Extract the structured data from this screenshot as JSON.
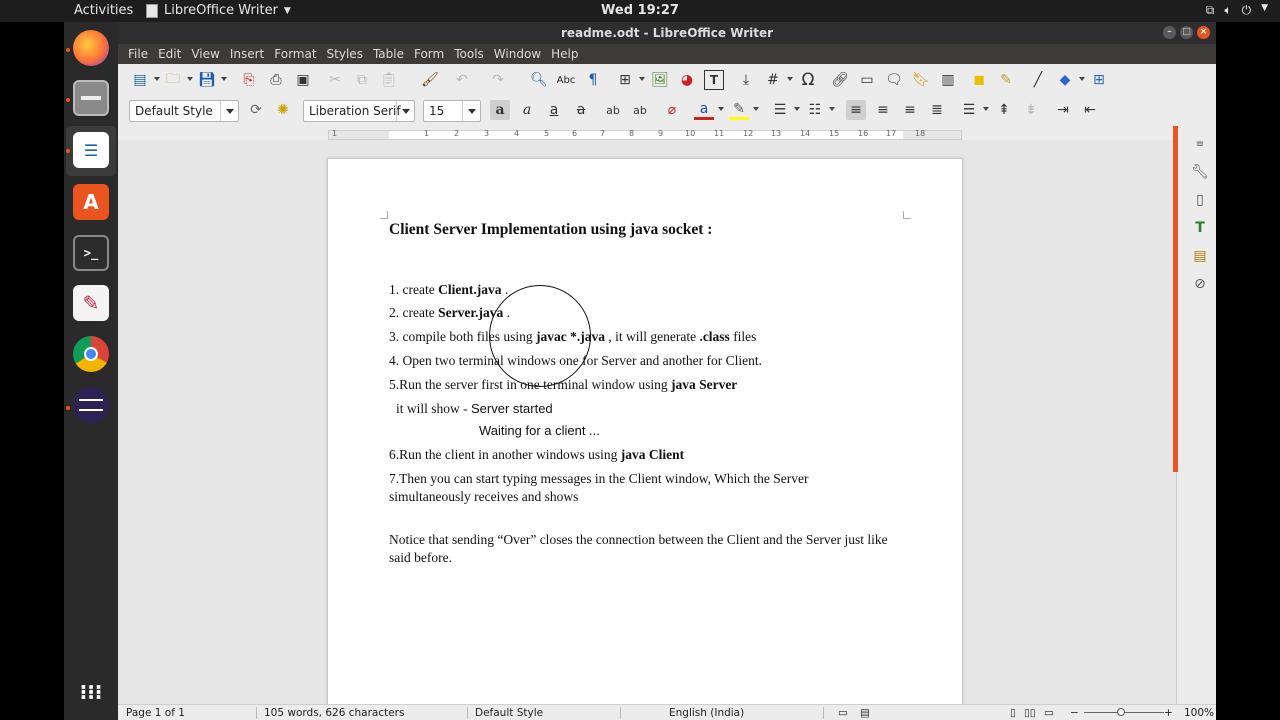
{
  "topbar": {
    "activities": "Activities",
    "app_name": "LibreOffice Writer",
    "clock": "Wed 19:27",
    "tray_icons": [
      "network-icon",
      "volume-icon",
      "power-icon"
    ]
  },
  "dock": {
    "items": [
      "firefox-icon",
      "files-icon",
      "writer-icon",
      "software-center-icon",
      "terminal-icon",
      "text-editor-icon",
      "chrome-icon",
      "eclipse-icon",
      "app-grid-icon"
    ]
  },
  "window": {
    "title": "readme.odt - LibreOffice Writer"
  },
  "menu": [
    "File",
    "Edit",
    "View",
    "Insert",
    "Format",
    "Styles",
    "Table",
    "Form",
    "Tools",
    "Window",
    "Help"
  ],
  "formatting": {
    "paragraph_style": "Default Style",
    "font_name": "Liberation Serif",
    "font_size": "15"
  },
  "ruler": {
    "numbers": [
      "1",
      "1",
      "2",
      "3",
      "4",
      "5",
      "6",
      "7",
      "8",
      "9",
      "10",
      "11",
      "12",
      "13",
      "14",
      "15",
      "16",
      "17",
      "18"
    ]
  },
  "document": {
    "heading": "Client Server Implementation using java socket :",
    "step1_pre": "1. create ",
    "step1_bold": "Client.java",
    "step1_post": " .",
    "step2_pre": "2. create ",
    "step2_bold": "Server.java",
    "step2_post": " .",
    "step3_pre": "3. compile both files using ",
    "step3_bold1": "javac *.java",
    "step3_mid": " , it will generate ",
    "step3_bold2": ".class",
    "step3_post": " files",
    "step4": "4. Open two terminal windows one for Server and another for Client.",
    "step5_pre": "5.Run the server first in one terminal window using ",
    "step5_bold": "java Server",
    "show_label": "it will show - ",
    "output1": "Server started",
    "output2": "Waiting for a client ...",
    "step6_pre": "6.Run the client in another windows using ",
    "step6_bold": "java Client",
    "step7_line1": "7.Then you can start typing messages in the Client window, Which the Server",
    "step7_line2": "simultaneously receives and shows",
    "notice_line1": "Notice that sending “Over” closes the connection between the Client and the Server just like",
    "notice_line2": "said before."
  },
  "statusbar": {
    "page": "Page 1 of 1",
    "words": "105 words, 626 characters",
    "style": "Default Style",
    "language": "English (India)",
    "zoom": "100%"
  },
  "colors": {
    "accent": "#e95420",
    "menubar": "#3c3b37"
  }
}
